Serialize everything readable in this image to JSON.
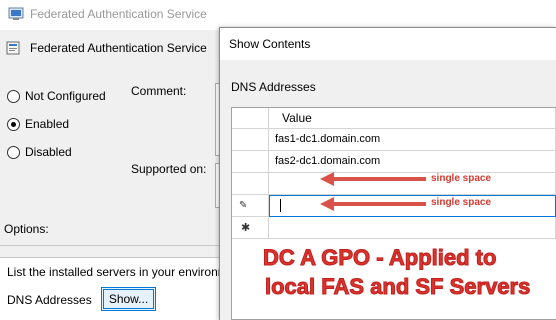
{
  "background_window": {
    "title": "Federated Authentication Service",
    "setting_name": "Federated Authentication Service",
    "radio_options": [
      {
        "label": "Not Configured",
        "selected": false
      },
      {
        "label": "Enabled",
        "selected": true
      },
      {
        "label": "Disabled",
        "selected": false
      }
    ],
    "comment_label": "Comment:",
    "supported_label": "Supported on:",
    "options_label": "Options:",
    "options_description": "List the installed servers in your environment",
    "dns_addresses_label": "DNS Addresses",
    "show_button_label": "Show..."
  },
  "dialog": {
    "title": "Show Contents",
    "heading": "DNS Addresses",
    "column_header": "Value",
    "rows": [
      {
        "value": "fas1-dc1.domain.com"
      },
      {
        "value": "fas2-dc1.domain.com"
      },
      {
        "value": ""
      },
      {
        "value": ""
      },
      {
        "value": ""
      }
    ],
    "edit_row_icon": "pencil-icon",
    "new_row_icon": "asterisk-icon"
  },
  "annotations": {
    "note_1": "single space",
    "note_2": "single space",
    "overlay_line_1": "DC A GPO - Applied to",
    "overlay_line_2": "local FAS and SF Servers",
    "color": "#d9352b"
  }
}
